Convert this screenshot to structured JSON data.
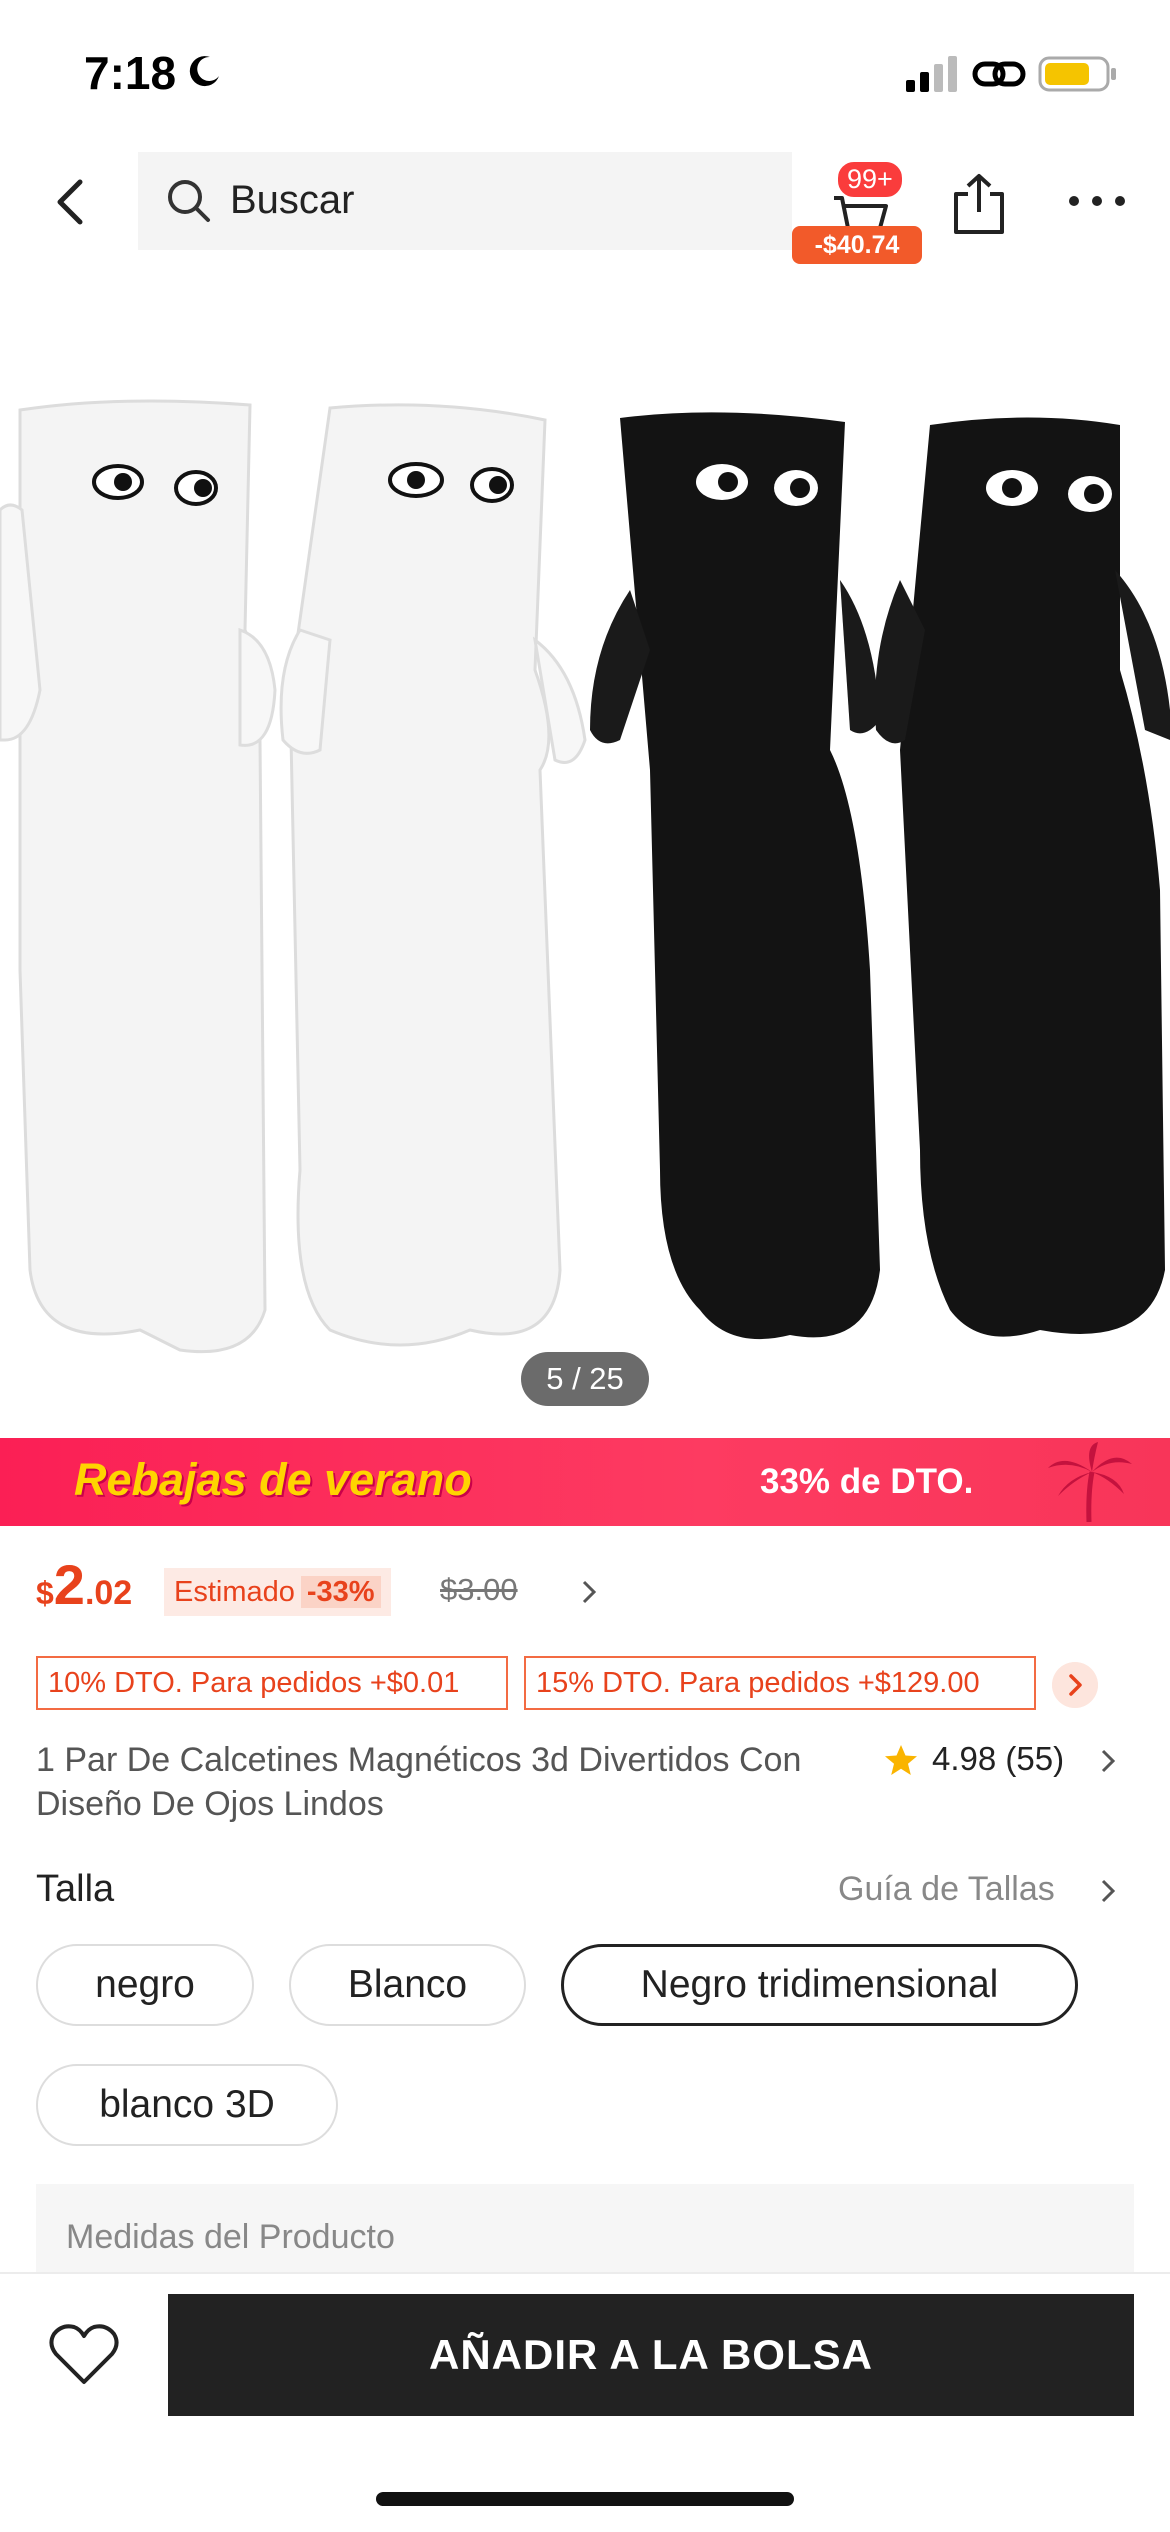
{
  "status_bar": {
    "time": "7:18",
    "icons": [
      "moon-icon",
      "signal-icon",
      "link-icon",
      "battery-icon"
    ],
    "battery_color": "#f5c400"
  },
  "nav": {
    "search_placeholder": "Buscar",
    "cart_count": "99+",
    "cart_saving": "-$40.74",
    "icons": [
      "chevron-left-icon",
      "search-icon",
      "cart-icon",
      "share-icon",
      "more-icon"
    ]
  },
  "gallery": {
    "image_subject": "socks-photo",
    "counter": "5 / 25"
  },
  "promo": {
    "title": "Rebajas de verano",
    "discount": "33% de DTO.",
    "colors": {
      "background": "#fb1f55",
      "title": "#ffd400"
    }
  },
  "price": {
    "currency": "$",
    "integer": "2",
    "decimal": ".02",
    "estimated_label": "Estimado",
    "discount_pct": "-33%",
    "original": "$3.00",
    "color": "#e8421c"
  },
  "coupons": [
    {
      "label": "10% DTO. Para pedidos +$0.01"
    },
    {
      "label": "15% DTO. Para pedidos +$129.00"
    }
  ],
  "product": {
    "title": "1 Par De Calcetines Magnéticos 3d Divertidos Con Diseño De Ojos Lindos",
    "rating": "4.98",
    "reviews": "(55)"
  },
  "size": {
    "label": "Talla",
    "guide": "Guía de Tallas",
    "options": [
      {
        "label": "negro",
        "selected": false
      },
      {
        "label": "Blanco",
        "selected": false
      },
      {
        "label": "Negro tridimensional",
        "selected": true
      },
      {
        "label": "blanco 3D",
        "selected": false
      }
    ]
  },
  "measures_label": "Medidas del Producto",
  "bottom": {
    "add_to_bag": "AÑADIR A LA BOLSA"
  }
}
